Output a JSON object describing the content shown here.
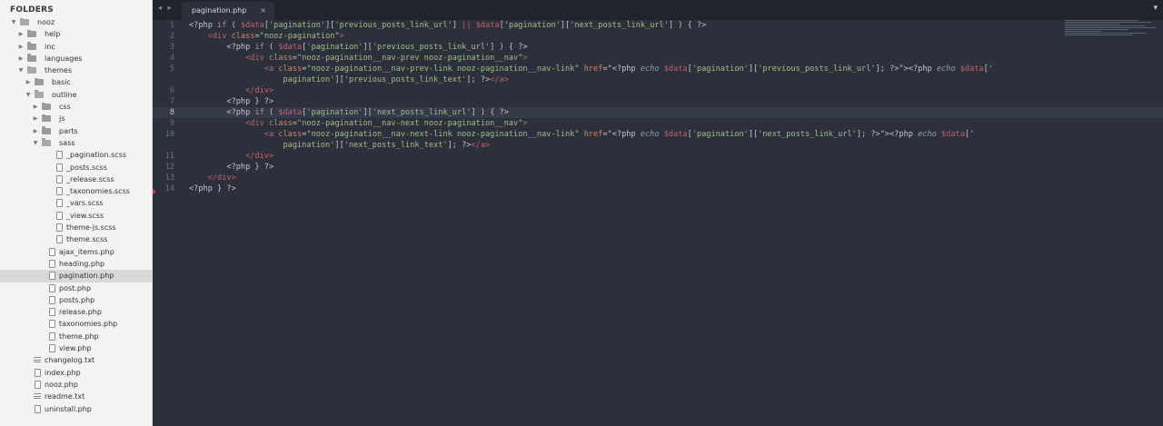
{
  "sidebar": {
    "header": "FOLDERS",
    "tree": [
      {
        "label": "nooz",
        "kind": "folder",
        "open": true,
        "depth": 0
      },
      {
        "label": "help",
        "kind": "folder",
        "open": false,
        "depth": 1
      },
      {
        "label": "inc",
        "kind": "folder",
        "open": false,
        "depth": 1
      },
      {
        "label": "languages",
        "kind": "folder",
        "open": false,
        "depth": 1
      },
      {
        "label": "themes",
        "kind": "folder",
        "open": true,
        "depth": 1
      },
      {
        "label": "basic",
        "kind": "folder",
        "open": false,
        "depth": 2
      },
      {
        "label": "outline",
        "kind": "folder",
        "open": true,
        "depth": 2
      },
      {
        "label": "css",
        "kind": "folder",
        "open": false,
        "depth": 3
      },
      {
        "label": "js",
        "kind": "folder",
        "open": false,
        "depth": 3
      },
      {
        "label": "parts",
        "kind": "folder",
        "open": false,
        "depth": 3
      },
      {
        "label": "sass",
        "kind": "folder",
        "open": true,
        "depth": 3
      },
      {
        "label": "_pagination.scss",
        "kind": "file",
        "depth": 4
      },
      {
        "label": "_posts.scss",
        "kind": "file",
        "depth": 4
      },
      {
        "label": "_release.scss",
        "kind": "file",
        "depth": 4
      },
      {
        "label": "_taxonomies.scss",
        "kind": "file",
        "depth": 4
      },
      {
        "label": "_vars.scss",
        "kind": "file",
        "depth": 4
      },
      {
        "label": "_view.scss",
        "kind": "file",
        "depth": 4
      },
      {
        "label": "theme-js.scss",
        "kind": "file",
        "depth": 4
      },
      {
        "label": "theme.scss",
        "kind": "file",
        "depth": 4
      },
      {
        "label": "ajax_items.php",
        "kind": "file",
        "depth": 3
      },
      {
        "label": "heading.php",
        "kind": "file",
        "depth": 3
      },
      {
        "label": "pagination.php",
        "kind": "file",
        "depth": 3,
        "selected": true
      },
      {
        "label": "post.php",
        "kind": "file",
        "depth": 3
      },
      {
        "label": "posts.php",
        "kind": "file",
        "depth": 3
      },
      {
        "label": "release.php",
        "kind": "file",
        "depth": 3
      },
      {
        "label": "taxonomies.php",
        "kind": "file",
        "depth": 3
      },
      {
        "label": "theme.php",
        "kind": "file",
        "depth": 3
      },
      {
        "label": "view.php",
        "kind": "file",
        "depth": 3
      },
      {
        "label": "changelog.txt",
        "kind": "text",
        "depth": 1
      },
      {
        "label": "index.php",
        "kind": "file",
        "depth": 1
      },
      {
        "label": "nooz.php",
        "kind": "file",
        "depth": 1
      },
      {
        "label": "readme.txt",
        "kind": "text",
        "depth": 1
      },
      {
        "label": "uninstall.php",
        "kind": "file",
        "depth": 1
      }
    ]
  },
  "tabbar": {
    "nav_arrows": "◂ ▸",
    "active_tab": {
      "label": "pagination.php",
      "close": "×"
    },
    "dropdown": "▾"
  },
  "editor": {
    "current_line": 8,
    "lines": [
      {
        "n": "1",
        "tokens": [
          [
            "php",
            "<?php "
          ],
          [
            "kw",
            "if"
          ],
          [
            "op",
            " ( "
          ],
          [
            "var",
            "$data"
          ],
          [
            "op",
            "["
          ],
          [
            "str",
            "'pagination'"
          ],
          [
            "op",
            "]["
          ],
          [
            "str",
            "'previous_posts_link_url'"
          ],
          [
            "op",
            "] "
          ],
          [
            "red",
            "||"
          ],
          [
            "op",
            " "
          ],
          [
            "var",
            "$data"
          ],
          [
            "op",
            "["
          ],
          [
            "str",
            "'pagination'"
          ],
          [
            "op",
            "]["
          ],
          [
            "str",
            "'next_posts_link_url'"
          ],
          [
            "op",
            "] ) { ?>"
          ]
        ]
      },
      {
        "n": "2",
        "tokens": [
          [
            "op",
            "    "
          ],
          [
            "tag",
            "<div"
          ],
          [
            "op",
            " "
          ],
          [
            "at",
            "class"
          ],
          [
            "op",
            "="
          ],
          [
            "str",
            "\"nooz-pagination\""
          ],
          [
            "tag",
            ">"
          ]
        ]
      },
      {
        "n": "3",
        "tokens": [
          [
            "op",
            "        <?php "
          ],
          [
            "kw",
            "if"
          ],
          [
            "op",
            " ( "
          ],
          [
            "var",
            "$data"
          ],
          [
            "op",
            "["
          ],
          [
            "str",
            "'pagination'"
          ],
          [
            "op",
            "]["
          ],
          [
            "str",
            "'previous_posts_link_url'"
          ],
          [
            "op",
            "] ) { ?>"
          ]
        ]
      },
      {
        "n": "4",
        "tokens": [
          [
            "op",
            "            "
          ],
          [
            "tag",
            "<div"
          ],
          [
            "op",
            " "
          ],
          [
            "at",
            "class"
          ],
          [
            "op",
            "="
          ],
          [
            "str",
            "\"nooz-pagination__nav-prev nooz-pagination__nav\""
          ],
          [
            "tag",
            ">"
          ]
        ]
      },
      {
        "n": "5",
        "tokens": [
          [
            "op",
            "                "
          ],
          [
            "tag",
            "<a"
          ],
          [
            "op",
            " "
          ],
          [
            "at",
            "class"
          ],
          [
            "op",
            "="
          ],
          [
            "str",
            "\"nooz-pagination__nav-prev-link nooz-pagination__nav-link\""
          ],
          [
            "op",
            " "
          ],
          [
            "at",
            "href"
          ],
          [
            "op",
            "=\"<?php "
          ],
          [
            "it",
            "echo"
          ],
          [
            "op",
            " "
          ],
          [
            "var",
            "$data"
          ],
          [
            "op",
            "["
          ],
          [
            "str",
            "'pagination'"
          ],
          [
            "op",
            "]["
          ],
          [
            "str",
            "'previous_posts_link_url'"
          ],
          [
            "op",
            "]; ?>\">"
          ],
          [
            "op",
            "<?php "
          ],
          [
            "it",
            "echo"
          ],
          [
            "op",
            " "
          ],
          [
            "var",
            "$data"
          ],
          [
            "op",
            "["
          ],
          [
            "str",
            "'"
          ]
        ]
      },
      {
        "n": "",
        "tokens": [
          [
            "op",
            "                    "
          ],
          [
            "str",
            "pagination'"
          ],
          [
            "op",
            "]["
          ],
          [
            "str",
            "'previous_posts_link_text'"
          ],
          [
            "op",
            "]; ?>"
          ],
          [
            "tag",
            "</a>"
          ]
        ]
      },
      {
        "n": "6",
        "tokens": [
          [
            "op",
            "            "
          ],
          [
            "tag",
            "</div>"
          ]
        ]
      },
      {
        "n": "7",
        "tokens": [
          [
            "op",
            "        <?php } ?>"
          ]
        ]
      },
      {
        "n": "8",
        "tokens": [
          [
            "op",
            "        <?php "
          ],
          [
            "kw",
            "if"
          ],
          [
            "op",
            " ( "
          ],
          [
            "var",
            "$data"
          ],
          [
            "op",
            "["
          ],
          [
            "str",
            "'pagination'"
          ],
          [
            "op",
            "]["
          ],
          [
            "str",
            "'next_posts_link_url'"
          ],
          [
            "op",
            "] ) { ?>"
          ]
        ]
      },
      {
        "n": "9",
        "tokens": [
          [
            "op",
            "            "
          ],
          [
            "tag",
            "<div"
          ],
          [
            "op",
            " "
          ],
          [
            "at",
            "class"
          ],
          [
            "op",
            "="
          ],
          [
            "str",
            "\"nooz-pagination__nav-next nooz-pagination__nav\""
          ],
          [
            "tag",
            ">"
          ]
        ]
      },
      {
        "n": "10",
        "tokens": [
          [
            "op",
            "                "
          ],
          [
            "tag",
            "<a"
          ],
          [
            "op",
            " "
          ],
          [
            "at",
            "class"
          ],
          [
            "op",
            "="
          ],
          [
            "str",
            "\"nooz-pagination__nav-next-link nooz-pagination__nav-link\""
          ],
          [
            "op",
            " "
          ],
          [
            "at",
            "href"
          ],
          [
            "op",
            "=\"<?php "
          ],
          [
            "it",
            "echo"
          ],
          [
            "op",
            " "
          ],
          [
            "var",
            "$data"
          ],
          [
            "op",
            "["
          ],
          [
            "str",
            "'pagination'"
          ],
          [
            "op",
            "]["
          ],
          [
            "str",
            "'next_posts_link_url'"
          ],
          [
            "op",
            "]; ?>\">"
          ],
          [
            "op",
            "<?php "
          ],
          [
            "it",
            "echo"
          ],
          [
            "op",
            " "
          ],
          [
            "var",
            "$data"
          ],
          [
            "op",
            "["
          ],
          [
            "str",
            "'"
          ]
        ]
      },
      {
        "n": "",
        "tokens": [
          [
            "op",
            "                    "
          ],
          [
            "str",
            "pagination'"
          ],
          [
            "op",
            "]["
          ],
          [
            "str",
            "'next_posts_link_text'"
          ],
          [
            "op",
            "]; ?>"
          ],
          [
            "tag",
            "</a>"
          ]
        ]
      },
      {
        "n": "11",
        "tokens": [
          [
            "op",
            "            "
          ],
          [
            "tag",
            "</div>"
          ]
        ]
      },
      {
        "n": "12",
        "tokens": [
          [
            "op",
            "        <?php } ?>"
          ]
        ]
      },
      {
        "n": "13",
        "tokens": [
          [
            "op",
            "    "
          ],
          [
            "tag",
            "</div>"
          ]
        ]
      },
      {
        "n": "14",
        "tokens": [
          [
            "op",
            "<?php } ?>"
          ]
        ]
      }
    ]
  },
  "colors": {
    "editor_bg": "#2b303b",
    "sidebar_bg": "#f3f3f3",
    "tag": "#bf616a",
    "string": "#a3be8c",
    "keyword": "#b48ead",
    "attribute": "#d08770"
  }
}
